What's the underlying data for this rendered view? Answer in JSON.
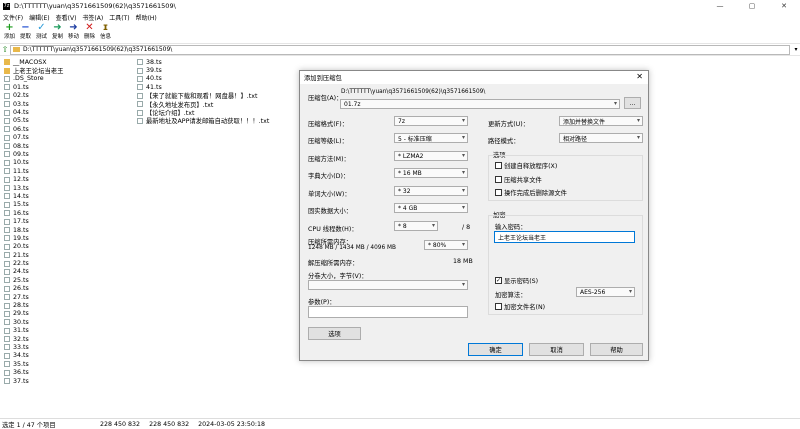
{
  "window": {
    "title": "D:\\TTTTTT\\yuan\\q3571661509(62)\\q3571661509\\",
    "controls": [
      "—",
      "▢",
      "✕"
    ]
  },
  "menu": [
    "文件(F)",
    "编辑(E)",
    "查看(V)",
    "书签(A)",
    "工具(T)",
    "帮助(H)"
  ],
  "toolbar": [
    {
      "label": "添加",
      "icon": "plus-icon",
      "glyph": "+",
      "color": "#1a9a1a"
    },
    {
      "label": "提取",
      "icon": "minus-icon",
      "glyph": "−",
      "color": "#1a4ad0"
    },
    {
      "label": "测试",
      "icon": "check-icon",
      "glyph": "✓",
      "color": "#2a9ad8"
    },
    {
      "label": "复制",
      "icon": "copy-arrow-icon",
      "glyph": "➜",
      "color": "#1a9a5a"
    },
    {
      "label": "移动",
      "icon": "move-arrow-icon",
      "glyph": "➜",
      "color": "#1a3aa0"
    },
    {
      "label": "删除",
      "icon": "delete-icon",
      "glyph": "✕",
      "color": "#d01a1a"
    },
    {
      "label": "信息",
      "icon": "info-icon",
      "glyph": "ɪ",
      "color": "#806000"
    }
  ],
  "address": {
    "path": "D:\\TTTTTT\\yuan\\q3571661509(62)\\q3571661509\\"
  },
  "files_col1": [
    {
      "name": "__MACOSX",
      "type": "folder"
    },
    {
      "name": "上老王论坛当老王",
      "type": "folder"
    },
    {
      "name": ".DS_Store",
      "type": "file"
    },
    {
      "name": "01.ts",
      "type": "file"
    },
    {
      "name": "02.ts",
      "type": "file"
    },
    {
      "name": "03.ts",
      "type": "file"
    },
    {
      "name": "04.ts",
      "type": "file"
    },
    {
      "name": "05.ts",
      "type": "file"
    },
    {
      "name": "06.ts",
      "type": "file"
    },
    {
      "name": "07.ts",
      "type": "file"
    },
    {
      "name": "08.ts",
      "type": "file"
    },
    {
      "name": "09.ts",
      "type": "file"
    },
    {
      "name": "10.ts",
      "type": "file"
    },
    {
      "name": "11.ts",
      "type": "file"
    },
    {
      "name": "12.ts",
      "type": "file"
    },
    {
      "name": "13.ts",
      "type": "file"
    },
    {
      "name": "14.ts",
      "type": "file"
    },
    {
      "name": "15.ts",
      "type": "file"
    },
    {
      "name": "16.ts",
      "type": "file"
    },
    {
      "name": "17.ts",
      "type": "file"
    },
    {
      "name": "18.ts",
      "type": "file"
    },
    {
      "name": "19.ts",
      "type": "file"
    },
    {
      "name": "20.ts",
      "type": "file"
    },
    {
      "name": "21.ts",
      "type": "file"
    },
    {
      "name": "22.ts",
      "type": "file"
    },
    {
      "name": "24.ts",
      "type": "file"
    },
    {
      "name": "25.ts",
      "type": "file"
    },
    {
      "name": "26.ts",
      "type": "file"
    },
    {
      "name": "27.ts",
      "type": "file"
    },
    {
      "name": "28.ts",
      "type": "file"
    },
    {
      "name": "29.ts",
      "type": "file"
    },
    {
      "name": "30.ts",
      "type": "file"
    },
    {
      "name": "31.ts",
      "type": "file"
    },
    {
      "name": "32.ts",
      "type": "file"
    },
    {
      "name": "33.ts",
      "type": "file"
    },
    {
      "name": "34.ts",
      "type": "file"
    },
    {
      "name": "35.ts",
      "type": "file"
    },
    {
      "name": "36.ts",
      "type": "file"
    },
    {
      "name": "37.ts",
      "type": "file"
    }
  ],
  "files_col2": [
    {
      "name": "38.ts",
      "type": "file"
    },
    {
      "name": "39.ts",
      "type": "file"
    },
    {
      "name": "40.ts",
      "type": "file"
    },
    {
      "name": "41.ts",
      "type": "file"
    },
    {
      "name": "【来了就能下载和观看！网盘暴！】.txt",
      "type": "txt"
    },
    {
      "name": "【永久地址发布页】.txt",
      "type": "txt"
    },
    {
      "name": "【论坛介绍】.txt",
      "type": "txt"
    },
    {
      "name": "最新地址及APP请发邮箱自动获取！！！.txt",
      "type": "txt"
    }
  ],
  "status": {
    "selection": "选定 1 / 47 个项目",
    "size1": "228 450 832",
    "size2": "228 450 832",
    "date": "2024-03-05 23:50:18"
  },
  "dialog": {
    "title": "添加到压缩包",
    "close": "✕",
    "archive_label": "压缩包(A)：",
    "archive_path": "D:\\TTTTTT\\yuan\\q3571661509(62)\\q3571661509\\",
    "archive_name": "01.7z",
    "browse": "...",
    "format_label": "压缩格式(F)：",
    "format_value": "7z",
    "level_label": "压缩等级(L)：",
    "level_value": "5 - 标准压缩",
    "method_label": "压缩方法(M)：",
    "method_value": "* LZMA2",
    "dict_label": "字典大小(D)：",
    "dict_value": "* 16 MB",
    "word_label": "单词大小(W)：",
    "word_value": "* 32",
    "solid_label": "固实数据大小：",
    "solid_value": "* 4 GB",
    "cpu_label": "CPU 线程数(H)：",
    "cpu_value": "* 8",
    "cpu_max": "/ 8",
    "mem_label": "压缩所需内存：",
    "mem_value": "1248 MB / 1434 MB / 4096 MB",
    "mem_pct": "* 80%",
    "demem_label": "解压缩所需内存：",
    "demem_value": "18 MB",
    "split_label": "分卷大小，字节(V)：",
    "params_label": "参数(P)：",
    "options_btn": "选项",
    "update_label": "更新方式(U)：",
    "update_value": "添加并替换文件",
    "path_label": "路径模式：",
    "path_value": "相对路径",
    "opts_title": "选项",
    "opt_sfx": "创建自释放程序(X)",
    "opt_shared": "压缩共享文件",
    "opt_delete": "操作完成后删除源文件",
    "enc_title": "加密",
    "pwd_label": "输入密码：",
    "pwd_value": "上老王论坛当老王",
    "show_pwd": "显示密码(S)",
    "enc_method_label": "加密算法：",
    "enc_method_value": "AES-256",
    "enc_names": "加密文件名(N)",
    "ok": "确定",
    "cancel": "取消",
    "help": "帮助"
  }
}
